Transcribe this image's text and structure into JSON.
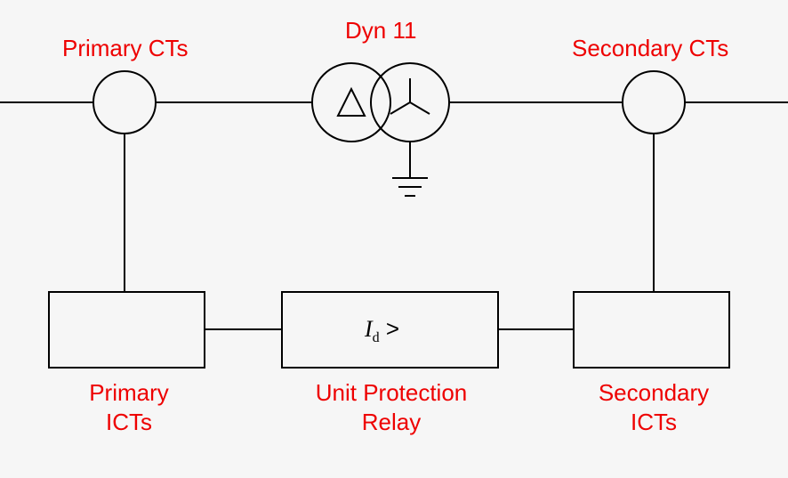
{
  "labels": {
    "primary_cts": "Primary CTs",
    "secondary_cts": "Secondary CTs",
    "vector_group": "Dyn 11",
    "primary_icts": "Primary\nICTs",
    "secondary_icts": "Secondary\nICTs",
    "relay_caption": "Unit Protection\nRelay"
  },
  "relay": {
    "symbol_I": "I",
    "symbol_sub": "d",
    "symbol_gt": " >"
  }
}
